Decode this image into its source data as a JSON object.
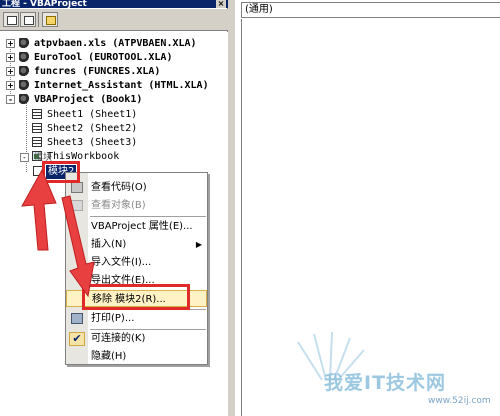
{
  "explorer": {
    "title": "工程 - VBAProject",
    "close_label": "×",
    "tree": [
      {
        "label": "atpvbaen.xls (ATPVBAEN.XLA)",
        "type": "project",
        "expander": "+"
      },
      {
        "label": "EuroTool (EUROTOOL.XLA)",
        "type": "project",
        "expander": "+"
      },
      {
        "label": "funcres (FUNCRES.XLA)",
        "type": "project",
        "expander": "+"
      },
      {
        "label": "Internet_Assistant (HTML.XLA)",
        "type": "project",
        "expander": "+"
      },
      {
        "label": "VBAProject (Book1)",
        "type": "project",
        "expander": "-"
      },
      {
        "label": "Sheet1 (Sheet1)",
        "type": "sheet"
      },
      {
        "label": "Sheet2 (Sheet2)",
        "type": "sheet"
      },
      {
        "label": "Sheet3 (Sheet3)",
        "type": "sheet"
      },
      {
        "label": "ThisWorkbook",
        "type": "workbook"
      },
      {
        "label": "模块",
        "type": "folder",
        "expander": "-"
      }
    ],
    "selected_item": "模块2"
  },
  "code_window": {
    "object_combo": "(通用)"
  },
  "context_menu": {
    "items": [
      {
        "label": "查看代码(O)",
        "enabled": true
      },
      {
        "label": "查看对象(B)",
        "enabled": false
      },
      {
        "label": "VBAProject 属性(E)...",
        "enabled": true
      },
      {
        "label": "插入(N)",
        "enabled": true,
        "submenu": true
      },
      {
        "label": "导入文件(I)...",
        "enabled": true
      },
      {
        "label": "导出文件(E)...",
        "enabled": true
      },
      {
        "label": "移除 模块2(R)...",
        "enabled": true,
        "highlighted": true
      },
      {
        "label": "打印(P)...",
        "enabled": true
      },
      {
        "label": "可连接的(K)",
        "enabled": true,
        "checked": true
      },
      {
        "label": "隐藏(H)",
        "enabled": true
      }
    ],
    "submenu_arrow": "▶",
    "check_mark": "✔"
  },
  "watermark": {
    "text": "我爱IT技术网",
    "url": "www.52ij.com"
  },
  "colors": {
    "annotation": "#e02a2a",
    "selection": "#0a246a",
    "menu_highlight": "#fff3c6"
  }
}
